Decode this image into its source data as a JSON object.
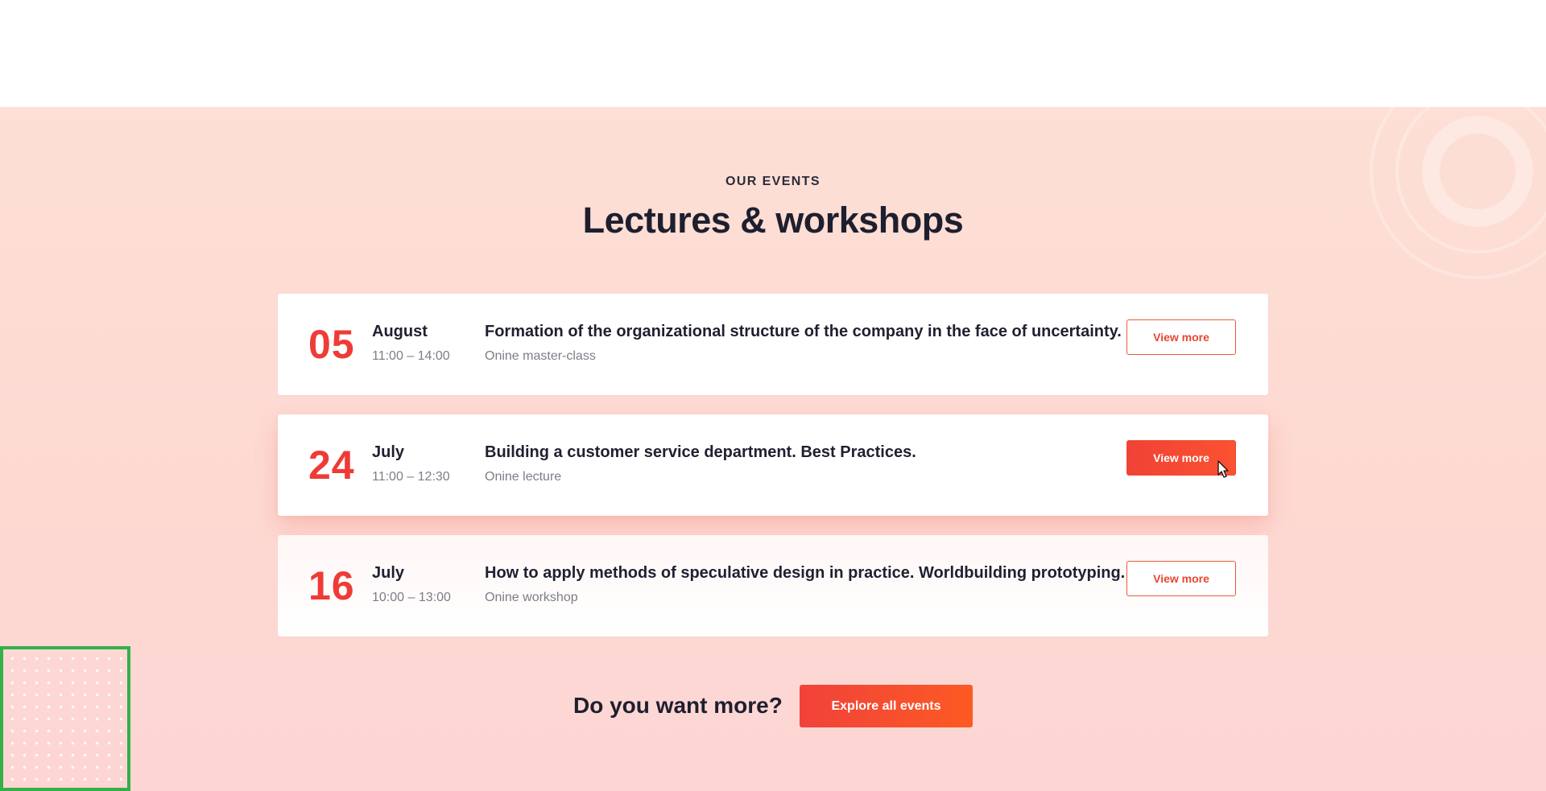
{
  "section": {
    "eyebrow": "OUR EVENTS",
    "title": "Lectures & workshops"
  },
  "events": [
    {
      "day": "05",
      "month": "August",
      "time": "11:00 – 14:00",
      "title": "Formation of the organizational structure of the company in the face of uncertainty.",
      "type": "Onine master-class",
      "button_label": "View more"
    },
    {
      "day": "24",
      "month": "July",
      "time": "11:00 – 12:30",
      "title": "Building a customer service department. Best Practices.",
      "type": "Onine lecture",
      "button_label": "View more"
    },
    {
      "day": "16",
      "month": "July",
      "time": "10:00 – 13:00",
      "title": "How to apply methods of speculative design in practice. Worldbuilding prototyping.",
      "type": "Onine workshop",
      "button_label": "View more"
    }
  ],
  "cta": {
    "text": "Do you want more?",
    "button_label": "Explore all events"
  },
  "colors": {
    "accent": "#ef3b36",
    "button_gradient_start": "#f1423a",
    "button_gradient_end": "#fc5a24",
    "section_background": "#fddcd4",
    "selection_outline": "#34b04a"
  },
  "icons": {
    "cursor": "mouse-pointer-icon",
    "decoration_rings": "concentric-rings-decoration",
    "decoration_dots": "dot-grid-decoration"
  }
}
